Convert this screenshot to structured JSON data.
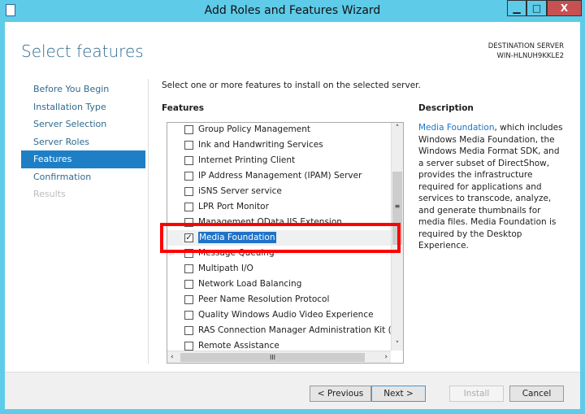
{
  "window": {
    "title": "Add Roles and Features Wizard",
    "minimize": "▁",
    "maximize": "□",
    "close": "X"
  },
  "page": {
    "title": "Select features",
    "dest_label": "DESTINATION SERVER",
    "dest_server": "WIN-HLNUH9KKLE2",
    "intro": "Select one or more features to install on the selected server."
  },
  "nav": [
    {
      "label": "Before You Begin"
    },
    {
      "label": "Installation Type"
    },
    {
      "label": "Server Selection"
    },
    {
      "label": "Server Roles"
    },
    {
      "label": "Features",
      "active": true
    },
    {
      "label": "Confirmation"
    },
    {
      "label": "Results",
      "disabled": true
    }
  ],
  "features": {
    "label": "Features",
    "items": [
      {
        "label": "Group Policy Management",
        "checked": false
      },
      {
        "label": "Ink and Handwriting Services",
        "checked": false
      },
      {
        "label": "Internet Printing Client",
        "checked": false
      },
      {
        "label": "IP Address Management (IPAM) Server",
        "checked": false
      },
      {
        "label": "iSNS Server service",
        "checked": false
      },
      {
        "label": "LPR Port Monitor",
        "checked": false
      },
      {
        "label": "Management OData IIS Extension",
        "checked": false
      },
      {
        "label": "Media Foundation",
        "checked": true,
        "selected": true
      },
      {
        "label": "Message Queuing",
        "checked": false,
        "expandable": true
      },
      {
        "label": "Multipath I/O",
        "checked": false
      },
      {
        "label": "Network Load Balancing",
        "checked": false
      },
      {
        "label": "Peer Name Resolution Protocol",
        "checked": false
      },
      {
        "label": "Quality Windows Audio Video Experience",
        "checked": false
      },
      {
        "label": "RAS Connection Manager Administration Kit (CMAK)",
        "checked": false
      },
      {
        "label": "Remote Assistance",
        "checked": false
      }
    ]
  },
  "description": {
    "label": "Description",
    "link": "Media Foundation",
    "text": ", which includes Windows Media Foundation, the Windows Media Format SDK, and a server subset of DirectShow, provides the infrastructure required for applications and services to transcode, analyze, and generate thumbnails for media files. Media Foundation is required by the Desktop Experience."
  },
  "buttons": {
    "previous": "< Previous",
    "next": "Next >",
    "install": "Install",
    "cancel": "Cancel"
  },
  "colors": {
    "accent": "#1e7fc6",
    "frame": "#5ecbe8",
    "highlight": "#ff0000",
    "close": "#c75050"
  }
}
